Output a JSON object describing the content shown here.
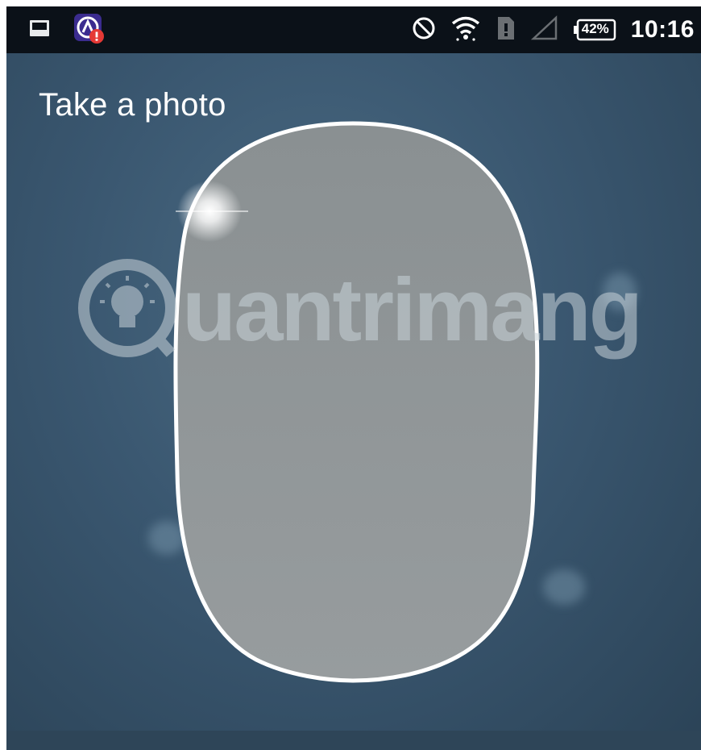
{
  "status_bar": {
    "time": "10:16",
    "battery_percent": "42%",
    "icons": [
      "image-notification-icon",
      "app-alert-icon",
      "do-not-disturb-icon",
      "wifi-icon",
      "sim-card-icon",
      "cellular-signal-icon",
      "battery-icon"
    ]
  },
  "camera": {
    "title": "Take a photo",
    "face_guide": "face-oval-outline"
  },
  "watermark": {
    "text": "uantrimang"
  },
  "colors": {
    "status_bar_bg": "#0b1118",
    "camera_bg": "#3a5770",
    "face_fill": "#8c9294",
    "face_outline": "#ffffff",
    "alert_badge": "#e53935",
    "app_icon_bg": "#3b2c8f"
  }
}
